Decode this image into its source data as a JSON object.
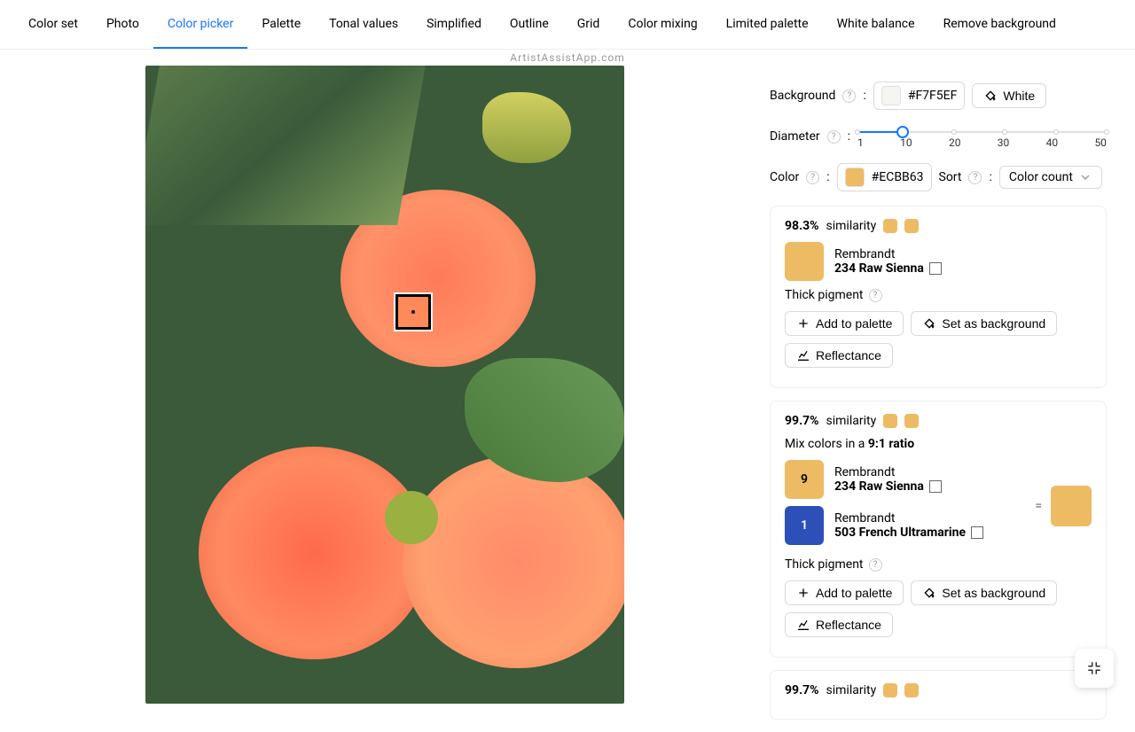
{
  "watermark": "ArtistAssistApp.com",
  "tabs": [
    {
      "label": "Color set"
    },
    {
      "label": "Photo"
    },
    {
      "label": "Color picker",
      "active": true
    },
    {
      "label": "Palette"
    },
    {
      "label": "Tonal values"
    },
    {
      "label": "Simplified"
    },
    {
      "label": "Outline"
    },
    {
      "label": "Grid"
    },
    {
      "label": "Color mixing"
    },
    {
      "label": "Limited palette"
    },
    {
      "label": "White balance"
    },
    {
      "label": "Remove background"
    }
  ],
  "background": {
    "label": "Background",
    "hex": "#F7F5EF",
    "white_btn": "White"
  },
  "diameter": {
    "label": "Diameter",
    "value": 10,
    "marks": [
      "1",
      "10",
      "20",
      "30",
      "40",
      "50"
    ]
  },
  "color": {
    "label": "Color",
    "hex": "#ECBB63"
  },
  "sort": {
    "label": "Sort",
    "value": "Color count"
  },
  "cards": [
    {
      "similarity": "98.3%",
      "sw1": "#ECBB63",
      "sw2": "#ECBB63",
      "paints": [
        {
          "ratio": "",
          "swatch": "#ECBB63",
          "brand": "Rembrandt",
          "name": "234 Raw Sienna"
        }
      ],
      "thick": "Thick pigment",
      "add": "Add to palette",
      "setbg": "Set as background",
      "refl": "Reflectance"
    },
    {
      "similarity": "99.7%",
      "sw1": "#ECBB63",
      "sw2": "#ECBB63",
      "mix_text_prefix": "Mix colors in a ",
      "mix_ratio": "9:1 ratio",
      "paints": [
        {
          "ratio": "9",
          "swatch": "#ECBB63",
          "brand": "Rembrandt",
          "name": "234 Raw Sienna"
        },
        {
          "ratio": "1",
          "swatch": "#2C4FB8",
          "brand": "Rembrandt",
          "name": "503 French Ultramarine"
        }
      ],
      "result": "#ECBB63",
      "thick": "Thick pigment",
      "add": "Add to palette",
      "setbg": "Set as background",
      "refl": "Reflectance"
    },
    {
      "similarity": "99.7%",
      "sw1": "#ECBB63",
      "sw2": "#ECBB63"
    }
  ]
}
